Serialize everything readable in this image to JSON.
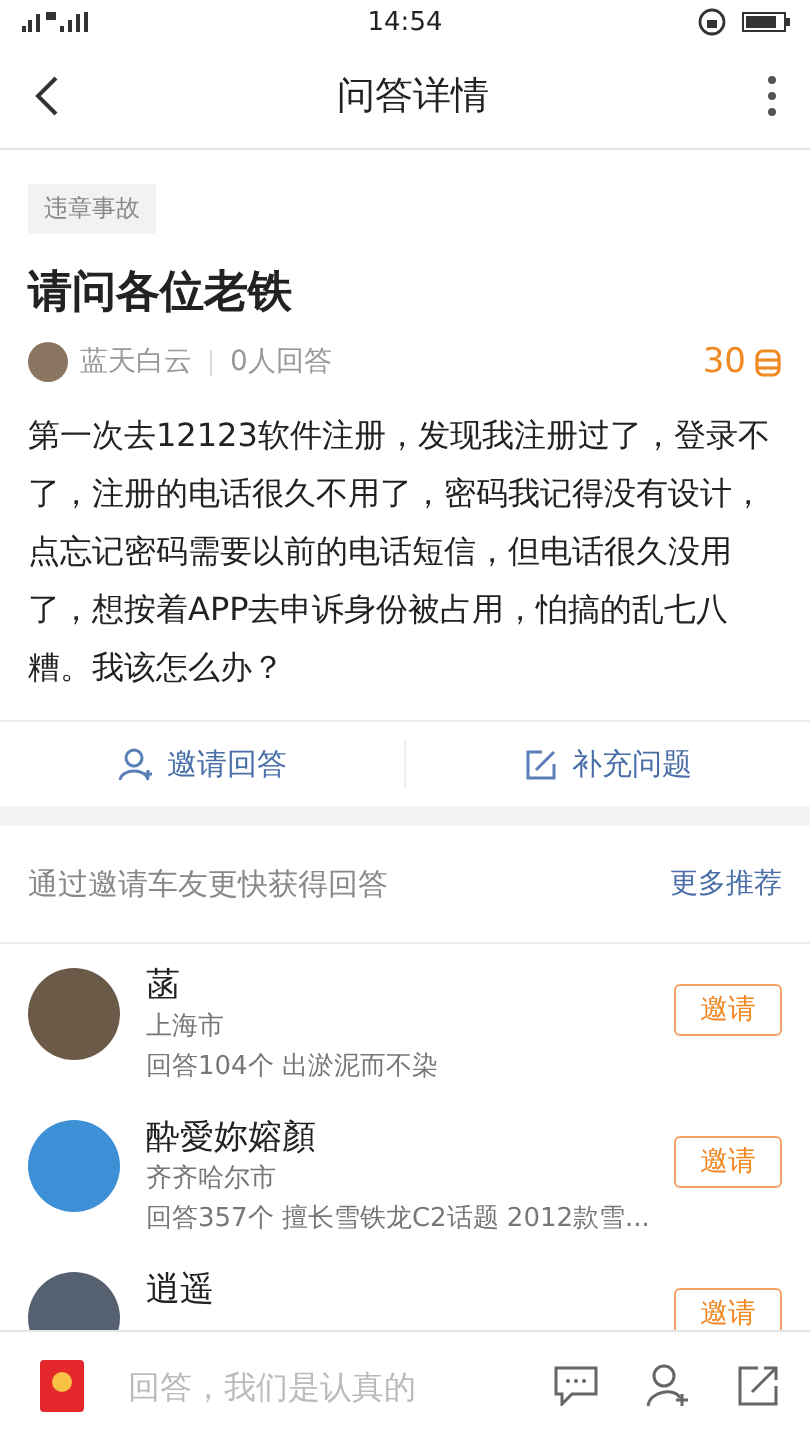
{
  "status_bar": {
    "time": "14:54"
  },
  "header": {
    "title": "问答详情"
  },
  "question": {
    "tag": "违章事故",
    "title": "请问各位老铁",
    "author": "蓝天白云",
    "answer_count": "0人回答",
    "reward": "30",
    "body": "第一次去12123软件注册，发现我注册过了，登录不了，注册的电话很久不用了，密码我记得没有设计，点忘记密码需要以前的电话短信，但电话很久没用了，想按着APP去申诉身份被占用，怕搞的乱七八糟。我该怎么办？"
  },
  "actions": [
    {
      "label": "邀请回答",
      "kind": "invite"
    },
    {
      "label": "补充问题",
      "kind": "edit"
    }
  ],
  "invite": {
    "heading": "通过邀请车友更快获得回答",
    "more": "更多推荐",
    "users": [
      {
        "name": "菡",
        "city": "上海市",
        "bio": "回答104个  出淤泥而不染",
        "button": "邀请"
      },
      {
        "name": "酔愛妳嫆顏",
        "city": "齐齐哈尔市",
        "bio": "回答357个 擅长雪铁龙C2话题 2012款雪...",
        "button": "邀请"
      },
      {
        "name": "逍遥",
        "button": "邀请"
      }
    ]
  },
  "bottom_bar": {
    "placeholder": "回答，我们是认真的"
  }
}
